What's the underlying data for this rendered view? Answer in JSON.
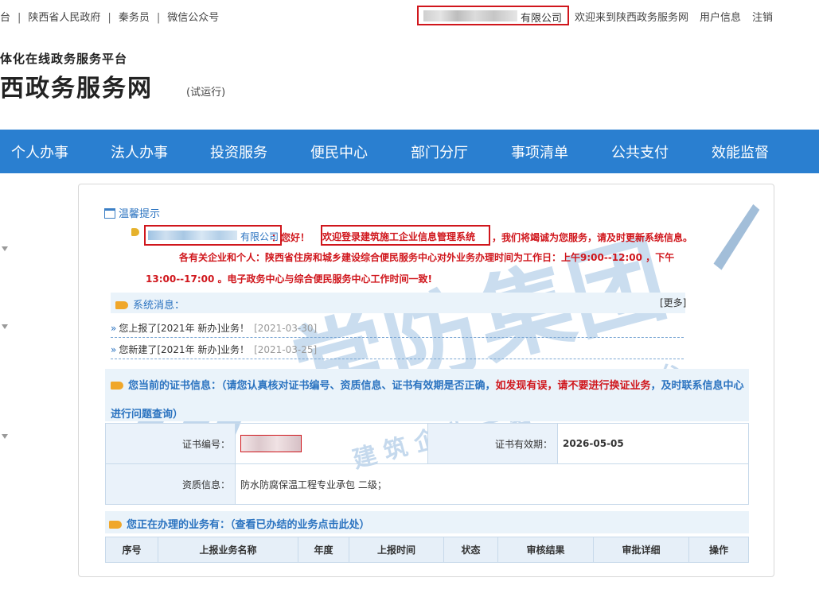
{
  "topbar": {
    "links": [
      "台",
      "陕西省人民政府",
      "秦务员",
      "微信公众号"
    ],
    "company_suffix": "有限公司",
    "welcome": "欢迎来到陕西政务服务网",
    "user_info": "用户信息",
    "logout": "注销"
  },
  "header": {
    "subtitle": "体化在线政务服务平台",
    "title": "西政务服务网",
    "trial": "(试运行)"
  },
  "nav": [
    "个人办事",
    "法人办事",
    "投资服务",
    "便民中心",
    "部门分厅",
    "事项清单",
    "公共支付",
    "效能监督"
  ],
  "tip": {
    "title": "温馨提示",
    "company_suffix": "有限公司",
    "greeting": "：您好！",
    "welcome_boxed": "欢迎登录建筑施工企业信息管理系统",
    "rest": "，我们将竭诚为您服务，请及时更新系统信息。",
    "notice_line1": "各有关企业和个人：陕西省住房和城乡建设综合便民服务中心对外业务办理时间为工作日：上午9:00--12:00 ，下午",
    "notice_line2": "13:00--17:00 。电子政务中心与综合便民服务中心工作时间一致!"
  },
  "system_msgs": {
    "title": "系统消息：",
    "more": "[更多]",
    "items": [
      {
        "text": "您上报了[2021年 新办]业务！",
        "date": "[2021-03-30]"
      },
      {
        "text": "您新建了[2021年 新办]业务！",
        "date": "[2021-03-25]"
      }
    ]
  },
  "cert": {
    "title_part1": "您当前的证书信息：（请您认真核对证书编号、资质信息、证书有效期是否正确，",
    "title_red": "如发现有误，请不要进行换证业务",
    "title_part2": "，及时联系信息中心进行问题查询）",
    "no_label": "证书编号：",
    "expiry_label": "证书有效期：",
    "expiry_value": "2026-05-05",
    "qual_label": "资质信息：",
    "qual_value": "防水防腐保温工程专业承包 二级；"
  },
  "business": {
    "title": "您正在办理的业务有：（查看已办结的业务点击此处）",
    "columns": [
      "序号",
      "上报业务名称",
      "年度",
      "上报时间",
      "状态",
      "审核结果",
      "审批详细",
      "操作"
    ]
  },
  "watermark": {
    "main": "常防集团",
    "sub": "建筑企业一站式服务平台"
  },
  "colors": {
    "nav_bg": "#2a7fd0",
    "link_blue": "#2b73c0",
    "alert_red": "#d0161c"
  }
}
